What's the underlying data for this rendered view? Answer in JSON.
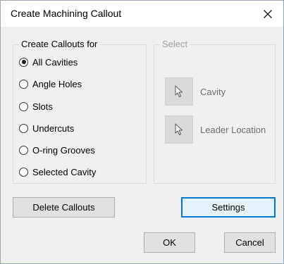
{
  "dialog": {
    "title": "Create Machining Callout",
    "close_icon": "close-icon"
  },
  "create_group": {
    "legend": "Create Callouts for",
    "options": [
      {
        "label": "All Cavities",
        "checked": true
      },
      {
        "label": "Angle Holes",
        "checked": false
      },
      {
        "label": "Slots",
        "checked": false
      },
      {
        "label": "Undercuts",
        "checked": false
      },
      {
        "label": "O-ring Grooves",
        "checked": false
      },
      {
        "label": "Selected Cavity",
        "checked": false
      }
    ]
  },
  "select_group": {
    "legend": "Select",
    "enabled": false,
    "items": [
      {
        "label": "Cavity",
        "icon": "pointer-icon"
      },
      {
        "label": "Leader Location",
        "icon": "pointer-icon"
      }
    ]
  },
  "buttons": {
    "delete_callouts": "Delete Callouts",
    "settings": "Settings",
    "ok": "OK",
    "cancel": "Cancel"
  },
  "colors": {
    "focus_border": "#0078d7",
    "disabled_text": "#a0a0a0",
    "pick_button_bg": "#dadada"
  }
}
